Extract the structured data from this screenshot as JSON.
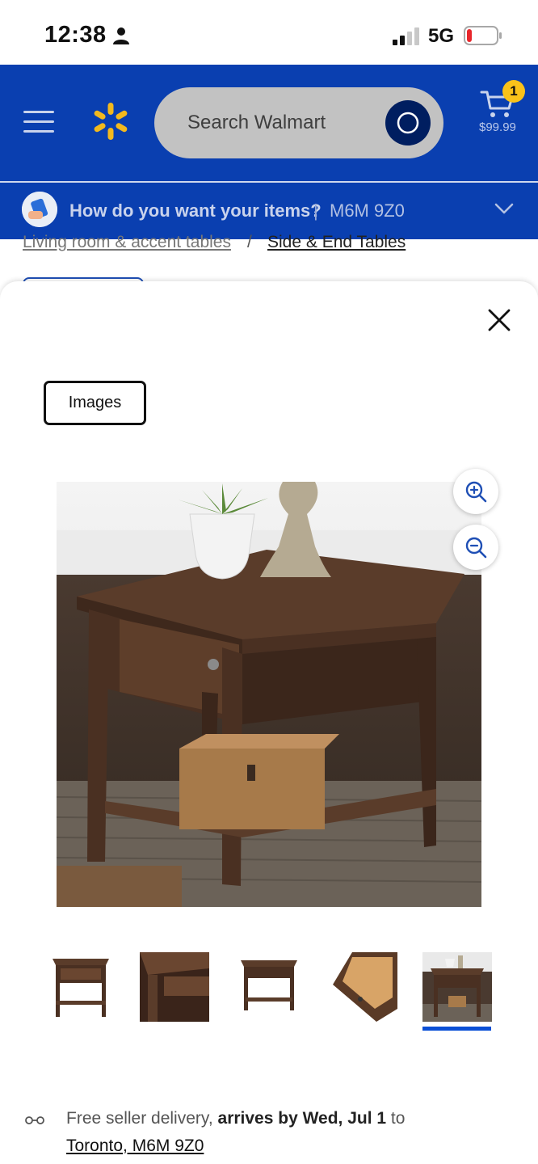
{
  "status_bar": {
    "time": "12:38",
    "network": "5G"
  },
  "header": {
    "search_placeholder": "Search Walmart",
    "cart_count": "1",
    "cart_total": "$99.99"
  },
  "delivery": {
    "question": "How do you want your items?",
    "separator": "|",
    "postal_code": "M6M 9Z0"
  },
  "breadcrumb": {
    "items": [
      "Living room & accent tables",
      "Side & End Tables"
    ],
    "separator": "/"
  },
  "modal": {
    "tab_label": "Images",
    "thumbnails_count": 5,
    "selected_thumbnail": 5
  },
  "footer": {
    "delivery_prefix": "Free seller delivery, ",
    "delivery_bold": "arrives by Wed, Jul 1",
    "delivery_suffix": " to",
    "location_link": "Toronto, M6M 9Z0"
  },
  "colors": {
    "brand_blue": "#0a3fb0",
    "spark_yellow": "#f9c21a",
    "search_button": "#001e60",
    "thumb_indicator": "#0a4fd6"
  },
  "icons": [
    "person-icon",
    "signal-icon",
    "battery-icon",
    "menu-icon",
    "spark-icon",
    "search-icon",
    "cart-icon",
    "chevron-down-icon",
    "close-icon",
    "zoom-in-icon",
    "zoom-out-icon",
    "delivery-truck-icon"
  ]
}
